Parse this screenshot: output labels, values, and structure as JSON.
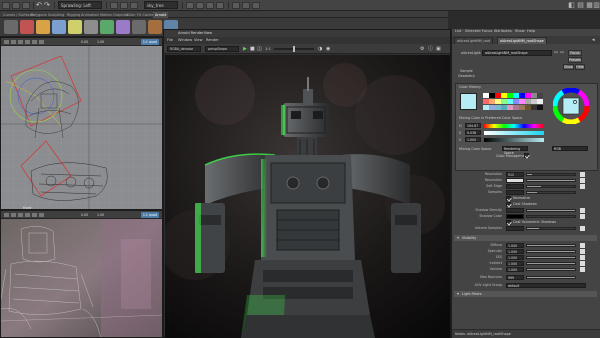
{
  "top": {
    "menu_set": "Sprawling: Left",
    "camera": "sky_tree",
    "symmetry_label": "Symmetry: Off"
  },
  "shelf_tabs": [
    "Curves / Surfaces",
    "Polygons",
    "Sculpting",
    "Rigging",
    "Animation",
    "Motion Graphics",
    "XGen",
    "FX Cache",
    "Arnold"
  ],
  "shelf_active_index": 8,
  "viewport_top": {
    "fields": [
      "0.00",
      "1.00"
    ],
    "resolution_badge": "1:1 quad",
    "label": "front"
  },
  "viewport_bottom": {
    "fields": [
      "0.00",
      "1.00"
    ],
    "resolution_badge": "1:1 quad"
  },
  "render_view": {
    "title": "Arnold RenderView",
    "menu": [
      "File",
      "Window",
      "View",
      "Render"
    ],
    "aov_dropdown": "RGBA_denoise",
    "camera_dropdown": "perspShape",
    "zoom_label": "1:1"
  },
  "attribute_editor": {
    "menu": [
      "List",
      "Selected",
      "Focus",
      "Attributes",
      "Show",
      "Help"
    ],
    "tabs": [
      "aiAreaLightNM_root",
      "aiAreaLightNM_rootShape"
    ],
    "active_tab_index": 1,
    "node_label": "aiAreaLight:",
    "node_name": "aiAreaLightNM_rootShape",
    "buttons": {
      "focus": "Focus",
      "presets": "Presets",
      "show": "Show",
      "hide": "Hide"
    },
    "sample_label": "Sample",
    "geometry_label": "Geometry",
    "color_history_label": "Color History",
    "mixing_color_label": "Mixing Color in Preferred Color Space",
    "hsv": {
      "h": "194.67",
      "s": "0.038",
      "v": "1.000"
    },
    "mixing_space_label": "Mixing Color Space",
    "mixing_space_value": "Rendering Space",
    "color_mgmt_label": "Color Management",
    "rgb_dropdown": "RGB",
    "attrs": [
      {
        "label": "Resolution",
        "value": "512"
      },
      {
        "label": "Resolution",
        "value": ""
      },
      {
        "label": "Soft Edge",
        "value": ""
      },
      {
        "label": "Samples",
        "value": ""
      },
      {
        "label": "Normalize",
        "value": ""
      },
      {
        "label": "Cast Shadows",
        "value": ""
      },
      {
        "label": "Shadow Density",
        "value": ""
      },
      {
        "label": "Shadow Color",
        "value": ""
      },
      {
        "label": "Cast Volumetric Shadows",
        "value": ""
      },
      {
        "label": "Volume Samples",
        "value": ""
      }
    ],
    "visibility_section": "Visibility",
    "visibility": [
      {
        "label": "Diffuse",
        "value": "1.000"
      },
      {
        "label": "Specular",
        "value": "1.000"
      },
      {
        "label": "SSS",
        "value": "1.000"
      },
      {
        "label": "Indirect",
        "value": "1.000"
      },
      {
        "label": "Volume",
        "value": "1.000"
      }
    ],
    "max_bounces_label": "Max Bounces",
    "max_bounces_value": "999",
    "aov_group_label": "AOV Light Group",
    "aov_group_value": "default",
    "light_filters_section": "Light Filters",
    "notes_label": "Notes: aiAreaLightNM_rootShape"
  },
  "colors": {
    "accent_blue": "#4d7ca8",
    "rim_light": "#3cff4a",
    "swatch_cyan": "#b6ecf4"
  }
}
